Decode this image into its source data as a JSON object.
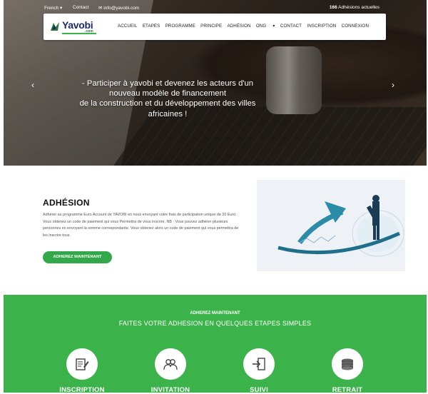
{
  "topbar": {
    "language": "French",
    "contact_label": "Contact",
    "email": "info@yavobi.com",
    "members_count": "166",
    "members_label": "Adhésions actuelles"
  },
  "logo": {
    "name": "Yavobi",
    "tld": ".com"
  },
  "nav": {
    "items": [
      "ACCUEIL",
      "ETAPES",
      "PROGRAMME",
      "PRINCIPE",
      "ADHÉSION",
      "ONG",
      "CONTACT",
      "INSCRIPTION",
      "CONNEXION"
    ]
  },
  "hero": {
    "line1": "- Participer à yavobi et devenez les acteurs d'un",
    "line2": "nouveau modèle de financement",
    "line3": "de la construction et du développement des villes",
    "line4": "africaines !"
  },
  "adhesion": {
    "title": "ADHÉSION",
    "text": "Adhérer au programme Euro Account de YAVOBI en nous envoyant votre frais de participation unique de 20 Euro. Vous obtenez un code de paiement qui vous Permettra de vous inscrire. NB : Vous pouvez adhérer plusieurs personnes en envoyant la somme correspondante. Vous obtenez alors un code de paiement qui vous permettra de les inscrire tous.",
    "button": "ADHEREZ MAINTENANT"
  },
  "steps_section": {
    "subtitle": "ADHEREZ MAINTENANT",
    "title": "FAITES VOTRE ADHESION EN QUELQUES ETAPES SIMPLES",
    "steps": [
      {
        "label": "INSCRIPTION",
        "icon": "edit-form-icon"
      },
      {
        "label": "INVITATION",
        "icon": "users-icon"
      },
      {
        "label": "SUIVI",
        "icon": "sign-in-icon"
      },
      {
        "label": "RETRAIT",
        "icon": "coins-icon"
      }
    ]
  },
  "colors": {
    "accent": "#3cb34a",
    "brand": "#1e2a6e"
  }
}
